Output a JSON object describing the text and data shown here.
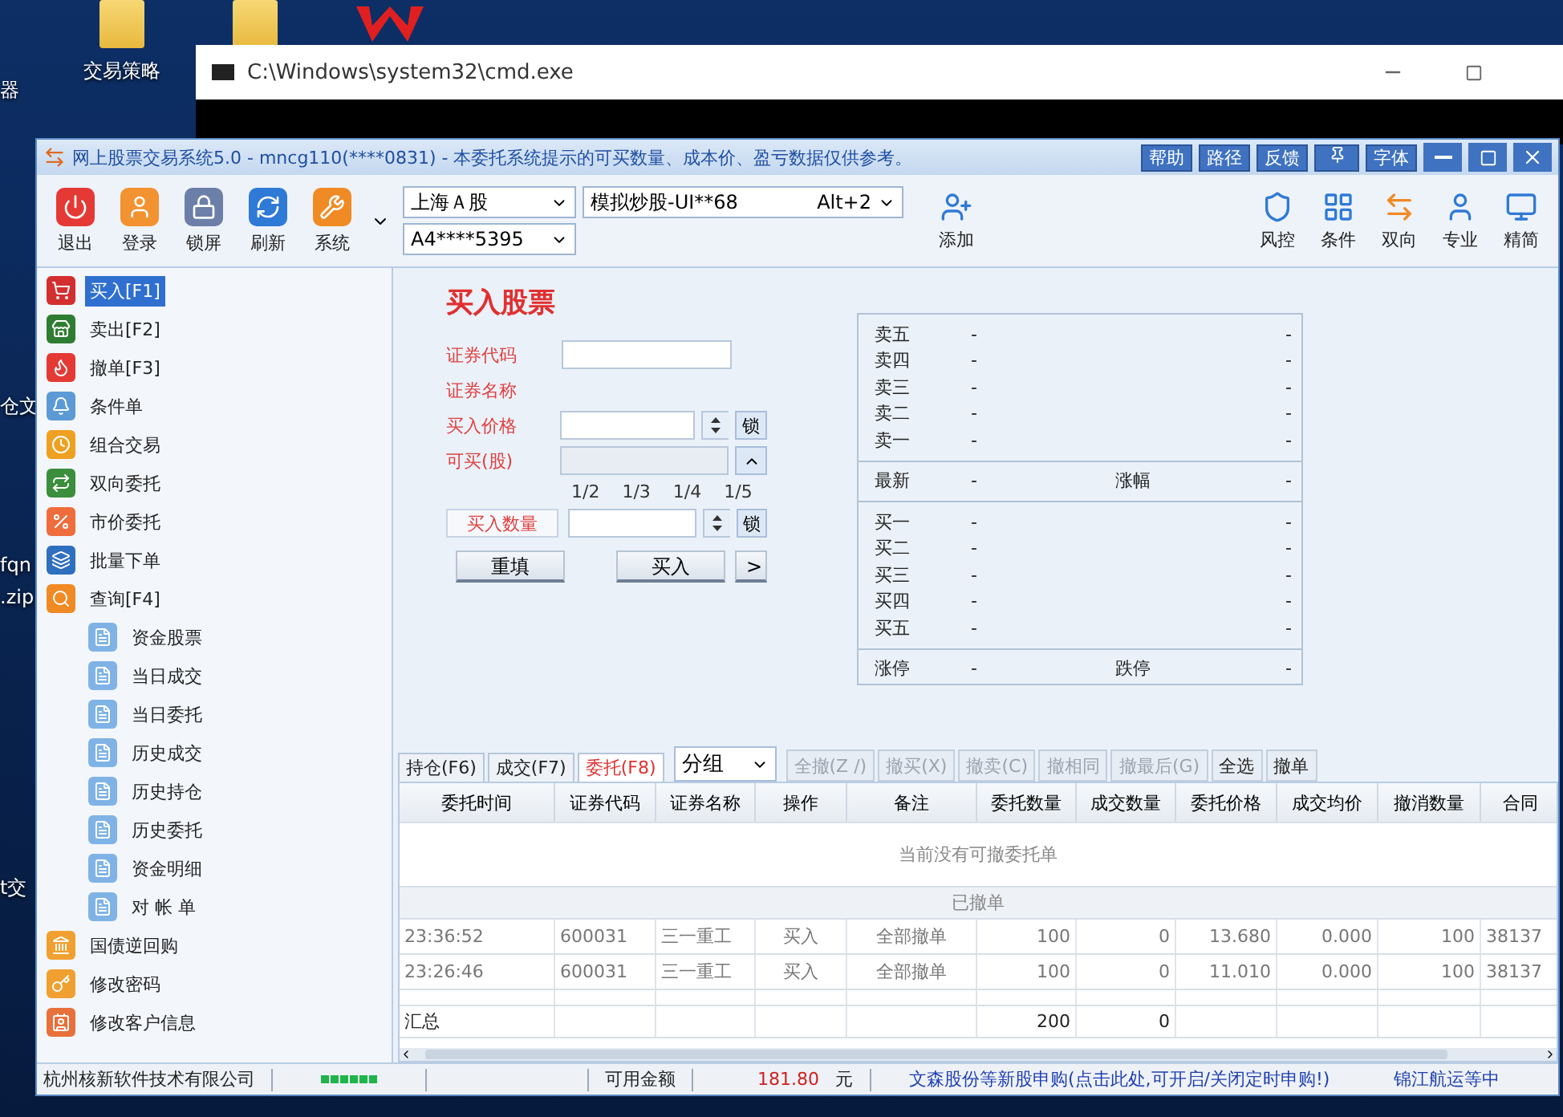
{
  "desktop": {
    "icons": [
      {
        "label": "器",
        "kind": "edge"
      },
      {
        "label": "交易策略",
        "kind": "folder"
      },
      {
        "label": "仓文",
        "kind": "edge"
      },
      {
        "label": "fqn",
        "kind": "edge"
      },
      {
        "label": ".zip",
        "kind": "edge"
      },
      {
        "label": "t交",
        "kind": "edge"
      }
    ]
  },
  "console_window": {
    "title": "C:\\Windows\\system32\\cmd.exe"
  },
  "window": {
    "title": "网上股票交易系统5.0 - mncg110(****0831) - 本委托系统提示的可买数量、成本价、盈亏数据仅供参考。",
    "title_buttons": [
      "帮助",
      "路径",
      "反馈",
      "字体"
    ]
  },
  "toolbar": {
    "left": [
      "退出",
      "登录",
      "锁屏",
      "刷新",
      "系统"
    ],
    "market": "上海Ａ股",
    "account": "模拟炒股-UI**68",
    "account_hotkey": "Alt+2",
    "holder": "A4****5395",
    "add": "添加",
    "right": [
      "风控",
      "条件",
      "双向",
      "专业",
      "精简"
    ]
  },
  "sidebar": {
    "items": [
      {
        "label": "买入[F1]",
        "selected": true
      },
      {
        "label": "卖出[F2]",
        "selected": false
      },
      {
        "label": "撤单[F3]",
        "selected": false
      },
      {
        "label": "条件单",
        "selected": false
      },
      {
        "label": "组合交易",
        "selected": false
      },
      {
        "label": "双向委托",
        "selected": false
      },
      {
        "label": "市价委托",
        "selected": false
      },
      {
        "label": "批量下单",
        "selected": false
      },
      {
        "label": "查询[F4]",
        "selected": false,
        "children": [
          {
            "label": "资金股票",
            "selected": false
          },
          {
            "label": "当日成交",
            "selected": false
          },
          {
            "label": "当日委托",
            "selected": false
          },
          {
            "label": "历史成交",
            "selected": false
          },
          {
            "label": "历史持仓",
            "selected": false
          },
          {
            "label": "历史委托",
            "selected": false
          },
          {
            "label": "资金明细",
            "selected": false
          },
          {
            "label": "对 帐 单",
            "selected": false
          }
        ]
      },
      {
        "label": "国债逆回购",
        "selected": false
      },
      {
        "label": "修改密码",
        "selected": false
      },
      {
        "label": "修改客户信息",
        "selected": false
      }
    ]
  },
  "order_form": {
    "title": "买入股票",
    "fields": [
      {
        "kind": "input",
        "label": "证券代码"
      },
      {
        "kind": "text",
        "label": "证券名称"
      },
      {
        "kind": "spinner",
        "label": "买入价格",
        "lock": "锁"
      },
      {
        "kind": "readonly",
        "label": "可买(股)"
      }
    ],
    "fractions": [
      "1/2",
      "1/3",
      "1/4",
      "1/5"
    ],
    "quantity": {
      "label": "买入数量",
      "lock": "锁"
    },
    "buttons": [
      "重填",
      "买入",
      ">"
    ]
  },
  "quote": {
    "sections": [
      {
        "rows": [
          {
            "label": "卖五",
            "value": "-",
            "value_2": "-"
          },
          {
            "label": "卖四",
            "value": "-",
            "value_2": "-"
          },
          {
            "label": "卖三",
            "value": "-",
            "value_2": "-"
          },
          {
            "label": "卖二",
            "value": "-",
            "value_2": "-"
          },
          {
            "label": "卖一",
            "value": "-",
            "value_2": "-"
          }
        ]
      },
      {
        "rows": [
          {
            "label": "最新",
            "value": "-",
            "label_2": "涨幅",
            "value_2": "-"
          }
        ]
      },
      {
        "rows": [
          {
            "label": "买一",
            "value": "-",
            "value_2": "-"
          },
          {
            "label": "买二",
            "value": "-",
            "value_2": "-"
          },
          {
            "label": "买三",
            "value": "-",
            "value_2": "-"
          },
          {
            "label": "买四",
            "value": "-",
            "value_2": "-"
          },
          {
            "label": "买五",
            "value": "-",
            "value_2": "-"
          }
        ]
      },
      {
        "rows": [
          {
            "label": "涨停",
            "value": "-",
            "label_2": "跌停",
            "value_2": "-"
          }
        ]
      }
    ]
  },
  "bottom_tabs": [
    {
      "label": "持仓(F6)",
      "selected": false
    },
    {
      "label": "成交(F7)",
      "selected": false
    },
    {
      "label": "委托(F8)",
      "selected": true
    }
  ],
  "actions": {
    "group": "分组",
    "buttons": [
      {
        "label": "全撤(Z /)",
        "disabled": true
      },
      {
        "label": "撤买(X)",
        "disabled": true
      },
      {
        "label": "撤卖(C)",
        "disabled": true
      },
      {
        "label": "撤相同",
        "disabled": true
      },
      {
        "label": "撤最后(G)",
        "disabled": true
      },
      {
        "label": "全选",
        "disabled": false
      },
      {
        "label": "撤单",
        "disabled": false
      }
    ]
  },
  "table": {
    "columns": [
      "委托时间",
      "证券代码",
      "证券名称",
      "操作",
      "备注",
      "委托数量",
      "成交数量",
      "委托价格",
      "成交均价",
      "撤消数量",
      "合同"
    ],
    "notice": "当前没有可撤委托单",
    "group": "已撤单",
    "rows": [
      [
        "23:36:52",
        "600031",
        "三一重工",
        "买入",
        "全部撤单",
        "100",
        "0",
        "13.680",
        "0.000",
        "100",
        "38137"
      ],
      [
        "23:26:46",
        "600031",
        "三一重工",
        "买入",
        "全部撤单",
        "100",
        "0",
        "11.010",
        "0.000",
        "100",
        "38137"
      ]
    ],
    "summary": {
      "label": "汇总",
      "order_qty": "200",
      "filled_qty": "0"
    }
  },
  "status_bar": {
    "company": "杭州核新软件技术有限公司",
    "balance_label": "可用金额",
    "balance": "181.80",
    "currency": "元",
    "notice": "文森股份等新股申购(点击此处,可开启/关闭定时申购!)",
    "notice_2": "锦江航运等中"
  }
}
